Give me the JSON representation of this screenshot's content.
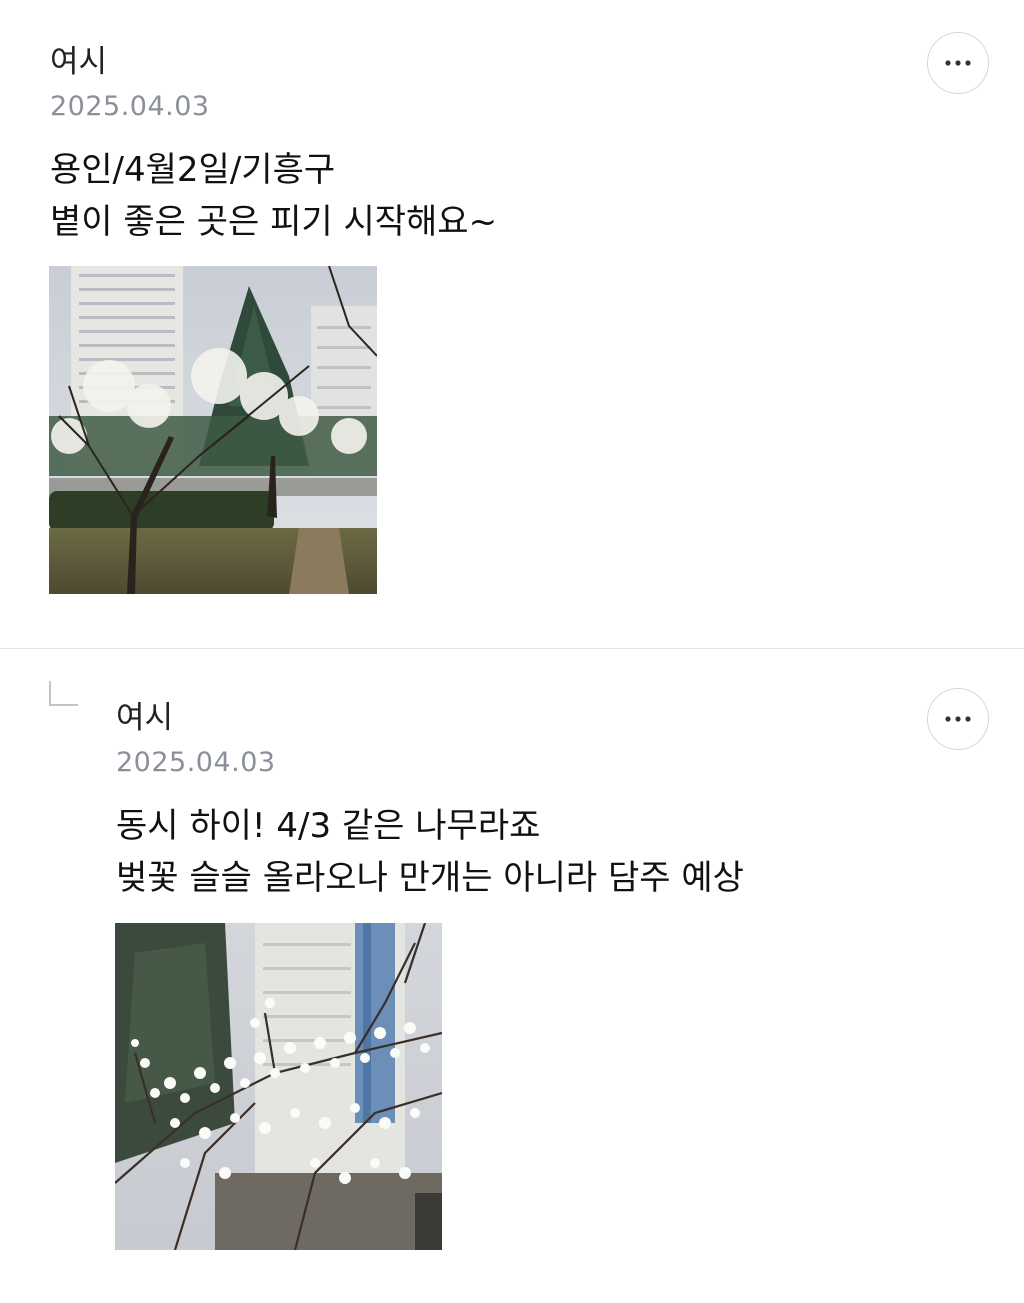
{
  "comments": [
    {
      "author": "여시",
      "date": "2025.04.03",
      "lines": [
        "용인/4월2일/기흥구",
        "볕이 좋은 곳은 피기 시작해요~"
      ],
      "more_icon": "more-horizontal-icon",
      "photo": "cherry-blossom-apartment-park-photo"
    },
    {
      "is_reply": true,
      "reply_icon": "reply-arrow-icon",
      "author": "여시",
      "date": "2025.04.03",
      "lines": [
        "동시 하이! 4/3 같은 나무라죠",
        "벚꽃 슬슬 올라오나 만개는 아니라 담주 예상"
      ],
      "more_icon": "more-horizontal-icon",
      "photo": "white-blossom-branches-photo"
    }
  ],
  "colors": {
    "text": "#111111",
    "date": "#8a8f99",
    "divider": "#e3e3e3",
    "button_border": "#d6d6d6"
  }
}
